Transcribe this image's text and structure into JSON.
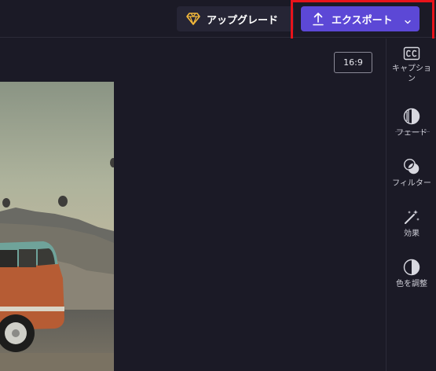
{
  "header": {
    "upgrade_label": "アップグレード",
    "export_label": "エクスポート"
  },
  "canvas": {
    "aspect_ratio": "16:9"
  },
  "sidebar": {
    "items": [
      {
        "label": "キャプション",
        "icon": "cc-icon"
      },
      {
        "label": "フェード",
        "icon": "fade-icon"
      },
      {
        "label": "フィルター",
        "icon": "filter-icon"
      },
      {
        "label": "効果",
        "icon": "magic-wand-icon"
      },
      {
        "label": "色を調整",
        "icon": "contrast-icon"
      }
    ]
  },
  "colors": {
    "background": "#1b1a26",
    "export_accent": "#5c48d6",
    "upgrade_bg": "#262535",
    "gem": "#f4b93b",
    "highlight": "#e8131b"
  }
}
